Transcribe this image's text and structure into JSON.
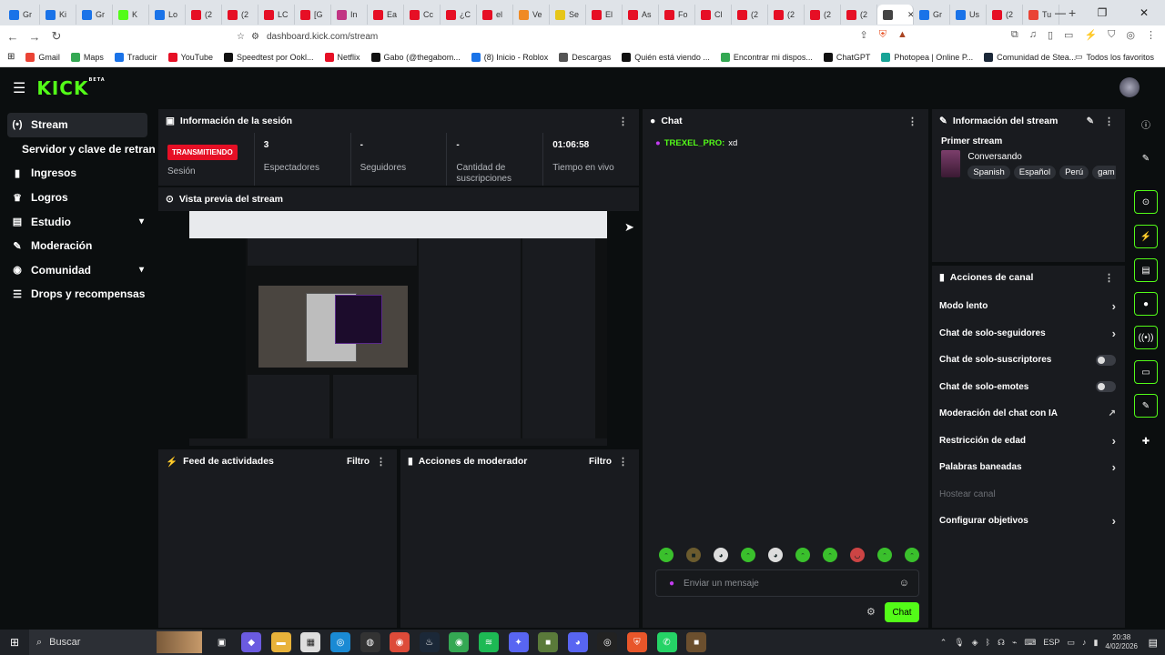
{
  "browser": {
    "tabs": [
      {
        "label": "Gr",
        "color": "#1a73e8"
      },
      {
        "label": "Ki",
        "color": "#1a73e8"
      },
      {
        "label": "Gr",
        "color": "#1a73e8"
      },
      {
        "label": "K",
        "color": "#53fc18"
      },
      {
        "label": "Lo",
        "color": "#1a73e8"
      },
      {
        "label": "(2",
        "color": "#e60f25"
      },
      {
        "label": "(2",
        "color": "#e60f25"
      },
      {
        "label": "LC",
        "color": "#e60f25"
      },
      {
        "label": "[G",
        "color": "#e60f25"
      },
      {
        "label": "In",
        "color": "#c13584"
      },
      {
        "label": "Ea",
        "color": "#e60f25"
      },
      {
        "label": "Cc",
        "color": "#e60f25"
      },
      {
        "label": "¿C",
        "color": "#e60f25"
      },
      {
        "label": "el",
        "color": "#e60f25"
      },
      {
        "label": "Ve",
        "color": "#f08a24"
      },
      {
        "label": "Se",
        "color": "#e6c619"
      },
      {
        "label": "El",
        "color": "#e60f25"
      },
      {
        "label": "As",
        "color": "#e60f25"
      },
      {
        "label": "Fo",
        "color": "#e60f25"
      },
      {
        "label": "Cl",
        "color": "#e60f25"
      },
      {
        "label": "(2",
        "color": "#e60f25"
      },
      {
        "label": "(2",
        "color": "#e60f25"
      },
      {
        "label": "(2",
        "color": "#e60f25"
      },
      {
        "label": "(2",
        "color": "#e60f25"
      },
      {
        "label": "",
        "color": "#444"
      },
      {
        "label": "Gr",
        "color": "#1a73e8"
      },
      {
        "label": "Us",
        "color": "#1a73e8"
      },
      {
        "label": "(2",
        "color": "#e60f25"
      },
      {
        "label": "Tu",
        "color": "#ea4335"
      }
    ],
    "url": "dashboard.kick.com/stream",
    "bookmarks": [
      {
        "label": "Gmail",
        "color": "#ea4335"
      },
      {
        "label": "Maps",
        "color": "#34a853"
      },
      {
        "label": "Traducir",
        "color": "#1a73e8"
      },
      {
        "label": "YouTube",
        "color": "#e60f25"
      },
      {
        "label": "Speedtest por Ookl...",
        "color": "#111"
      },
      {
        "label": "Netflix",
        "color": "#e60f25"
      },
      {
        "label": "Gabo (@thegabom...",
        "color": "#111"
      },
      {
        "label": "(8) Inicio - Roblox",
        "color": "#1a73e8"
      },
      {
        "label": "Descargas",
        "color": "#555"
      },
      {
        "label": "Quién está viendo ...",
        "color": "#111"
      },
      {
        "label": "Encontrar mi dispos...",
        "color": "#34a853"
      },
      {
        "label": "ChatGPT",
        "color": "#111"
      },
      {
        "label": "Photopea | Online P...",
        "color": "#18a497"
      },
      {
        "label": "Comunidad de Stea...",
        "color": "#1b2838"
      }
    ],
    "bookmarks_all": "Todos los favoritos"
  },
  "sidebar": {
    "items": [
      {
        "label": "Stream",
        "icon": "(•)"
      },
      {
        "label": "Servidor y clave de retransm",
        "icon": ""
      },
      {
        "label": "Ingresos",
        "icon": "▮"
      },
      {
        "label": "Logros",
        "icon": "♛"
      },
      {
        "label": "Estudio",
        "icon": "▤"
      },
      {
        "label": "Moderación",
        "icon": "✎"
      },
      {
        "label": "Comunidad",
        "icon": "◉"
      },
      {
        "label": "Drops y recompensas",
        "icon": "☰"
      }
    ]
  },
  "session": {
    "title": "Información de la sesión",
    "badge": "TRANSMITIENDO",
    "session_label": "Sesión",
    "viewers_value": "3",
    "viewers_label": "Espectadores",
    "followers_value": "-",
    "followers_label": "Seguidores",
    "subs_value": "-",
    "subs_label": "Cantidad de suscripciones",
    "time_value": "01:06:58",
    "time_label": "Tiempo en vivo"
  },
  "preview": {
    "title": "Vista previa del stream"
  },
  "feed": {
    "title": "Feed de actividades",
    "filter": "Filtro"
  },
  "modactions": {
    "title": "Acciones de moderador",
    "filter": "Filtro"
  },
  "chat": {
    "title": "Chat",
    "messages": [
      {
        "user": "TREXEL_PRO:",
        "text": "xd"
      }
    ],
    "placeholder": "Enviar un mensaje",
    "send": "Chat"
  },
  "stream_info": {
    "title": "Información del stream",
    "stream_title": "Primer stream",
    "category": "Conversando",
    "tags": [
      "Spanish",
      "Español",
      "Perú",
      "gam"
    ]
  },
  "channel_actions": {
    "title": "Acciones de canal",
    "items": [
      {
        "label": "Modo lento"
      },
      {
        "label": "Chat de solo-seguidores"
      },
      {
        "label": "Chat de solo-suscriptores"
      },
      {
        "label": "Chat de solo-emotes"
      },
      {
        "label": "Moderación del chat con IA"
      },
      {
        "label": "Restricción de edad"
      },
      {
        "label": "Palabras baneadas"
      },
      {
        "label": "Hostear canal"
      },
      {
        "label": "Configurar objetivos"
      }
    ]
  },
  "taskbar": {
    "search": "Buscar",
    "lang": "ESP",
    "time": "20:38",
    "date": "4/02/2026"
  }
}
